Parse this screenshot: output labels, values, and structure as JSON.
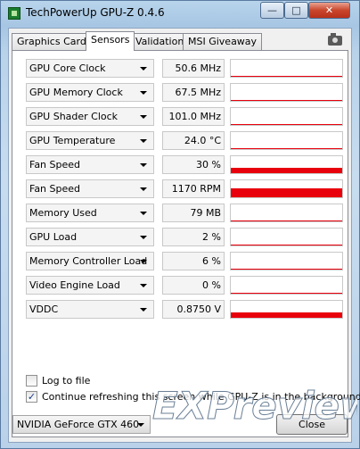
{
  "window": {
    "title": "TechPowerUp GPU-Z 0.4.6",
    "min_glyph": "—",
    "max_glyph": "□",
    "close_glyph": "✕"
  },
  "tabs": [
    {
      "label": "Graphics Card",
      "active": false
    },
    {
      "label": "Sensors",
      "active": true
    },
    {
      "label": "Validation",
      "active": false
    },
    {
      "label": "MSI Giveaway",
      "active": false
    }
  ],
  "sensors": [
    {
      "name": "GPU Core Clock",
      "value": "50.6 MHz",
      "level": 0.0
    },
    {
      "name": "GPU Memory Clock",
      "value": "67.5 MHz",
      "level": 0.0
    },
    {
      "name": "GPU Shader Clock",
      "value": "101.0 MHz",
      "level": 0.0
    },
    {
      "name": "GPU Temperature",
      "value": "24.0 °C",
      "level": 0.05
    },
    {
      "name": "Fan Speed",
      "value": "30 %",
      "level": 0.3
    },
    {
      "name": "Fan Speed",
      "value": "1170 RPM",
      "level": 0.5
    },
    {
      "name": "Memory Used",
      "value": "79 MB",
      "level": 0.05
    },
    {
      "name": "GPU Load",
      "value": "2 %",
      "level": 0.02
    },
    {
      "name": "Memory Controller Load",
      "value": "6 %",
      "level": 0.06
    },
    {
      "name": "Video Engine Load",
      "value": "0 %",
      "level": 0.0
    },
    {
      "name": "VDDC",
      "value": "0.8750 V",
      "level": 0.3
    }
  ],
  "options": {
    "log_to_file": {
      "label": "Log to file",
      "checked": false
    },
    "continue_refresh": {
      "label": "Continue refreshing this screen while GPU-Z is in the background",
      "checked": true
    }
  },
  "device": {
    "selected": "NVIDIA GeForce GTX 460"
  },
  "close_label": "Close",
  "watermark": {
    "text": "EXPreview"
  },
  "colors": {
    "graph": "#e8000c",
    "accent": "#1a7d2e"
  }
}
